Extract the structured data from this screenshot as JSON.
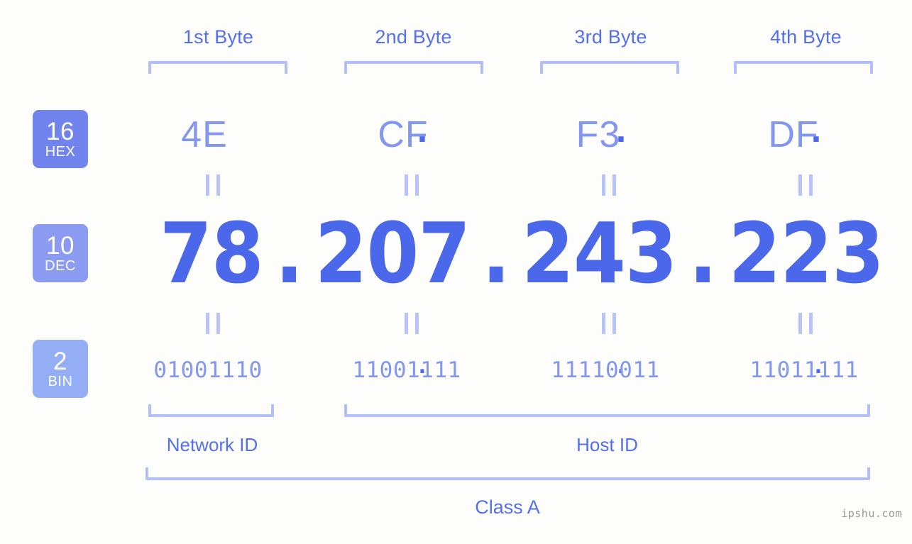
{
  "background": "#fdfefb",
  "accent": "#5570ee",
  "accent_light": "#8396f2",
  "bracket_color": "#b3befa",
  "byte_headers": [
    {
      "label": "1st Byte"
    },
    {
      "label": "2nd Byte"
    },
    {
      "label": "3rd Byte"
    },
    {
      "label": "4th Byte"
    }
  ],
  "bases": [
    {
      "num": "16",
      "abbr": "HEX",
      "color": "#7183ec"
    },
    {
      "num": "10",
      "abbr": "DEC",
      "color": "#8b9bf1"
    },
    {
      "num": "2",
      "abbr": "BIN",
      "color": "#94aef6"
    }
  ],
  "separator": ".",
  "rows": {
    "hex": {
      "values": [
        "4E",
        "CF",
        "F3",
        "DF"
      ]
    },
    "dec": {
      "values": [
        "78",
        "207",
        "243",
        "223"
      ]
    },
    "bin": {
      "values": [
        "01001110",
        "11001111",
        "11110011",
        "11011111"
      ]
    }
  },
  "segments": {
    "network_id": "Network ID",
    "host_id": "Host ID"
  },
  "class_label": "Class A",
  "watermark": "ipshu.com"
}
